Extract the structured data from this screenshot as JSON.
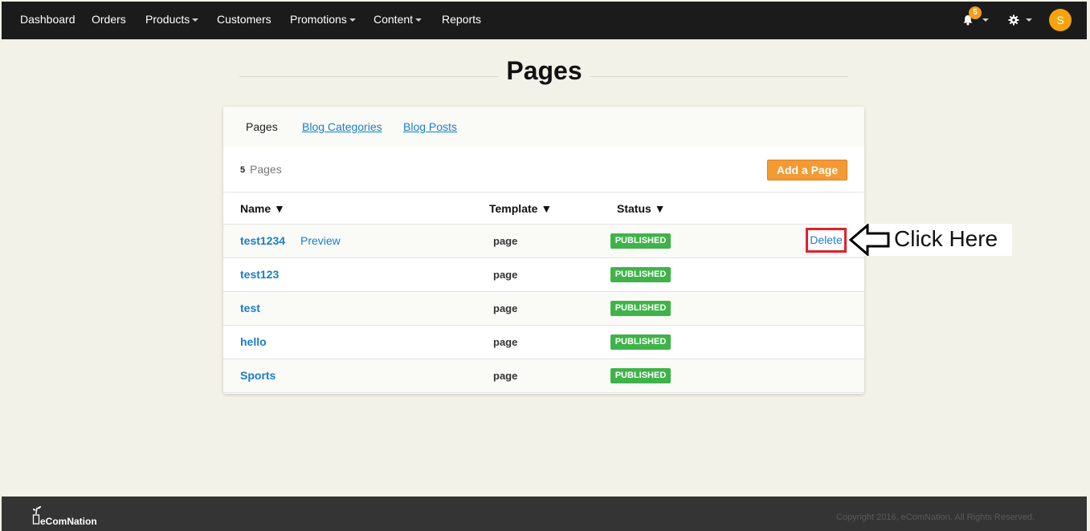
{
  "nav": {
    "items": [
      {
        "label": "Dashboard",
        "dropdown": false
      },
      {
        "label": "Orders",
        "dropdown": false
      },
      {
        "label": "Products",
        "dropdown": true
      },
      {
        "label": "Customers",
        "dropdown": false
      },
      {
        "label": "Promotions",
        "dropdown": true
      },
      {
        "label": "Content",
        "dropdown": true
      },
      {
        "label": "Reports",
        "dropdown": false
      }
    ],
    "notification_count": "5",
    "avatar_initial": "S",
    "icons": [
      "bell-icon",
      "gear-icon"
    ]
  },
  "page": {
    "title": "Pages"
  },
  "tabs": [
    {
      "label": "Pages",
      "active": true
    },
    {
      "label": "Blog Categories",
      "active": false
    },
    {
      "label": "Blog Posts",
      "active": false
    }
  ],
  "summary": {
    "count": "5",
    "label": "Pages",
    "add_button": "Add a Page"
  },
  "table": {
    "headers": {
      "name": "Name ▼",
      "template": "Template ▼",
      "status": "Status ▼"
    },
    "rows": [
      {
        "name": "test1234",
        "preview": "Preview",
        "template": "page",
        "status": "PUBLISHED"
      },
      {
        "name": "test123",
        "preview": "",
        "template": "page",
        "status": "PUBLISHED"
      },
      {
        "name": "test",
        "preview": "",
        "template": "page",
        "status": "PUBLISHED"
      },
      {
        "name": "hello",
        "preview": "",
        "template": "page",
        "status": "PUBLISHED"
      },
      {
        "name": "Sports",
        "preview": "",
        "template": "page",
        "status": "PUBLISHED"
      }
    ],
    "delete_label": "Delete"
  },
  "annotation": {
    "callout_text": "Click Here"
  },
  "footer": {
    "logo_text": "eComNation",
    "copyright": "Copyright 2016, eComNation. All Rights Reserved."
  },
  "colors": {
    "nav_bg": "#1b1b1b",
    "page_bg": "#f3f2e8",
    "link": "#1a7ec8",
    "accent_orange": "#f49a32",
    "published_green": "#3fb349",
    "highlight_red": "#e0202e"
  }
}
